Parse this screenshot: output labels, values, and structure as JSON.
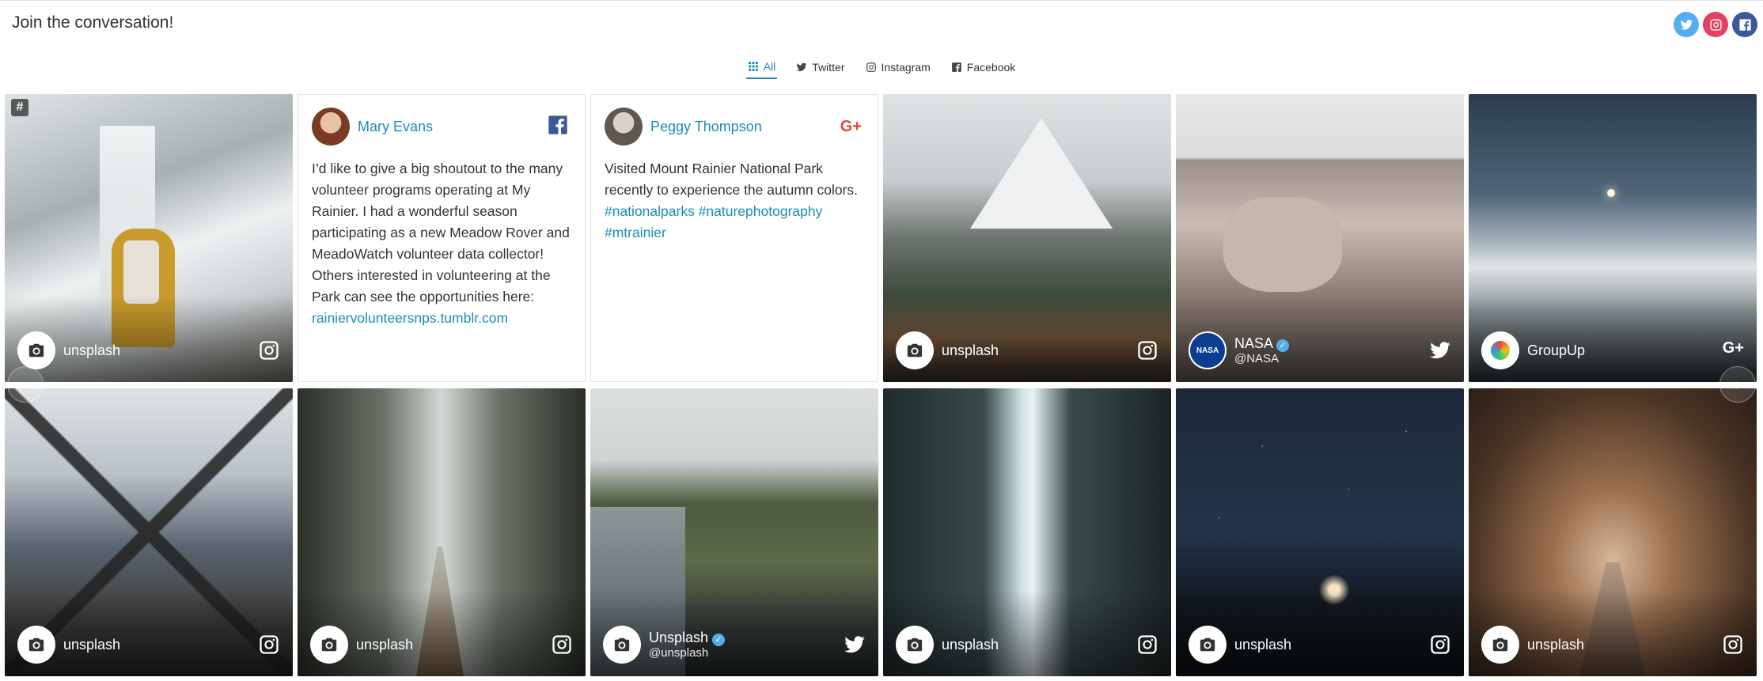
{
  "header": {
    "title": "Join the conversation!"
  },
  "social_icons": [
    "twitter-icon",
    "instagram-icon",
    "facebook-icon"
  ],
  "colors": {
    "accent": "#1b8db6",
    "twitter": "#55acee",
    "instagram": "#e4405f",
    "facebook": "#3b5998"
  },
  "tabs": [
    {
      "label": "All",
      "icon": "grid-icon",
      "active": true
    },
    {
      "label": "Twitter",
      "icon": "twitter-icon",
      "active": false
    },
    {
      "label": "Instagram",
      "icon": "instagram-icon",
      "active": false
    },
    {
      "label": "Facebook",
      "icon": "facebook-icon",
      "active": false
    }
  ],
  "posts": {
    "p1": {
      "user": "unsplash",
      "network": "instagram-icon",
      "badge": "#"
    },
    "p2": {
      "user": "Mary Evans",
      "network": "facebook-icon",
      "text": "I’d like to give a big shoutout to the many volunteer programs operating at My Rainier. I had a wonderful season participating as a new Meadow Rover and MeadoWatch volunteer data collector! Others interested in volunteering at the Park can see the opportunities here:",
      "link": "rainiervolunteersnps.tumblr.com"
    },
    "p3": {
      "user": "Peggy Thompson",
      "network": "google-plus-icon",
      "text": "Visited Mount Rainier National Park recently to experience the autumn colors.",
      "hashtags": "#nationalparks #naturephotography #mtrainier"
    },
    "p4": {
      "user": "unsplash",
      "network": "instagram-icon"
    },
    "p5": {
      "user": "NASA",
      "handle": "@NASA",
      "network": "twitter-icon"
    },
    "p6": {
      "user": "GroupUp",
      "network": "google-plus-icon"
    },
    "p7": {
      "user": "unsplash",
      "network": "instagram-icon"
    },
    "p8": {
      "user": "unsplash",
      "network": "instagram-icon"
    },
    "p9": {
      "user": "Unsplash",
      "handle": "@unsplash",
      "network": "twitter-icon"
    },
    "p10": {
      "user": "unsplash",
      "network": "instagram-icon"
    },
    "p11": {
      "user": "unsplash",
      "network": "instagram-icon"
    },
    "p12": {
      "user": "unsplash",
      "network": "instagram-icon"
    }
  },
  "carousel": {
    "prev": "‹",
    "next": "›"
  }
}
